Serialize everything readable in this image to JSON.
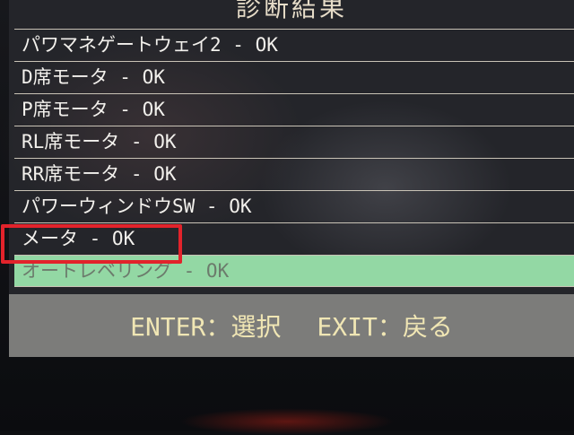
{
  "screen": {
    "title": "診断結果",
    "rows": [
      {
        "label": "パワマネゲートウェイ2 - OK"
      },
      {
        "label": "D席モータ - OK"
      },
      {
        "label": "P席モータ - OK"
      },
      {
        "label": "RL席モータ - OK"
      },
      {
        "label": "RR席モータ - OK"
      },
      {
        "label": "パワーウィンドウSW - OK"
      },
      {
        "label": "メータ - OK"
      },
      {
        "label": "オートレベリング - OK"
      }
    ],
    "footer": {
      "enter": "ENTER：選択",
      "exit": "EXIT：戻る"
    },
    "colors": {
      "selected_row": "#93d8a4",
      "highlight_box": "#e2232b",
      "footer_text": "#f0e6b4"
    }
  }
}
